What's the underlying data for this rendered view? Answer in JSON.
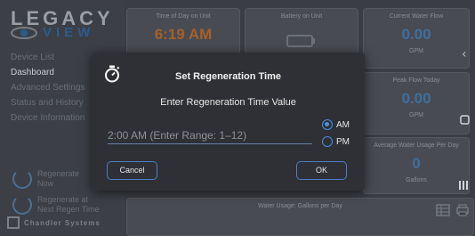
{
  "sidebar": {
    "logo_top": "LEGACY",
    "logo_bottom": "VIEW",
    "nav": [
      {
        "label": "Device List",
        "active": false
      },
      {
        "label": "Dashboard",
        "active": true
      },
      {
        "label": "Advanced Settings",
        "active": false
      },
      {
        "label": "Status and History",
        "active": false
      },
      {
        "label": "Device Information",
        "active": false
      }
    ],
    "regenerate_now": {
      "line1": "Regenerate",
      "line2": "Now"
    },
    "regenerate_next": {
      "line1": "Regenerate at",
      "line2": "Next Regen Time"
    },
    "brand": "Chandler Systems"
  },
  "cards": {
    "time_of_day": {
      "title": "Time of Day on Unit",
      "value": "6:19 AM"
    },
    "battery": {
      "title": "Battery on Unit"
    },
    "current_flow": {
      "title": "Current Water Flow",
      "value": "0.00",
      "unit": "GPM"
    },
    "peak_flow": {
      "title": "Peak Flow Today",
      "value": "0.00",
      "unit": "GPM"
    },
    "avg_usage": {
      "title": "Average Water Usage Per Day",
      "value": "0",
      "unit": "Gallons"
    },
    "usage_chart": {
      "title": "Water Usage: Gallons per Day"
    }
  },
  "dialog": {
    "title": "Set Regeneration Time",
    "prompt": "Enter Regeneration Time Value",
    "input_placeholder": "2:00 AM (Enter Range: 1–12)",
    "am_label": "AM",
    "pm_label": "PM",
    "selected_period": "AM",
    "cancel_label": "Cancel",
    "ok_label": "OK"
  },
  "colors": {
    "accent": "#4a8fe0",
    "value_blue": "#3f6f9e",
    "value_orange": "#a5612a"
  }
}
